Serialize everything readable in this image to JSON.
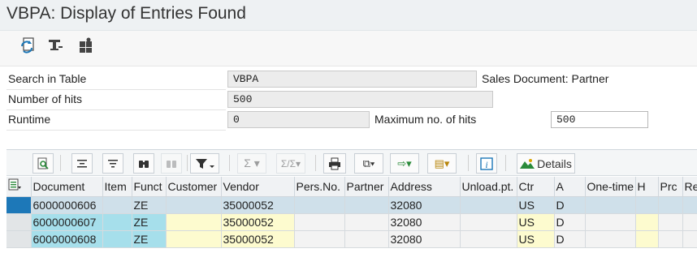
{
  "window": {
    "title": "VBPA: Display of Entries Found"
  },
  "toolbar": {
    "buttons": [
      {
        "name": "refresh-icon"
      },
      {
        "name": "filter-settings-icon"
      },
      {
        "name": "puzzle-icon"
      }
    ]
  },
  "form": {
    "search_label": "Search in Table",
    "search_value": "VBPA",
    "search_desc": "Sales Document: Partner",
    "hits_label": "Number of hits",
    "hits_value": "500",
    "runtime_label": "Runtime",
    "runtime_value": "0",
    "max_label": "Maximum no. of hits",
    "max_value": "500"
  },
  "alv_toolbar": {
    "details_label": "Details"
  },
  "table": {
    "columns": [
      "Document",
      "Item",
      "Funct",
      "Customer",
      "Vendor",
      "Pers.No.",
      "Partner",
      "Address",
      "Unload.pt.",
      "Ctr",
      "A",
      "One-time",
      "H",
      "Prc",
      "Rel"
    ],
    "rows": [
      [
        "6000000606",
        "",
        "ZE",
        "",
        "35000052",
        "",
        "",
        "32080",
        "",
        "US",
        "D",
        "",
        "",
        "",
        ""
      ],
      [
        "6000000607",
        "",
        "ZE",
        "",
        "35000052",
        "",
        "",
        "32080",
        "",
        "US",
        "D",
        "",
        "",
        "",
        ""
      ],
      [
        "6000000608",
        "",
        "ZE",
        "",
        "35000052",
        "",
        "",
        "32080",
        "",
        "US",
        "D",
        "",
        "",
        "",
        ""
      ]
    ]
  },
  "colors": {
    "key_column": "#a6dfeb",
    "highlight_column": "#fdfbcf",
    "selected_row": "#cfe0ea",
    "row_marker_selected": "#1d78b8"
  }
}
